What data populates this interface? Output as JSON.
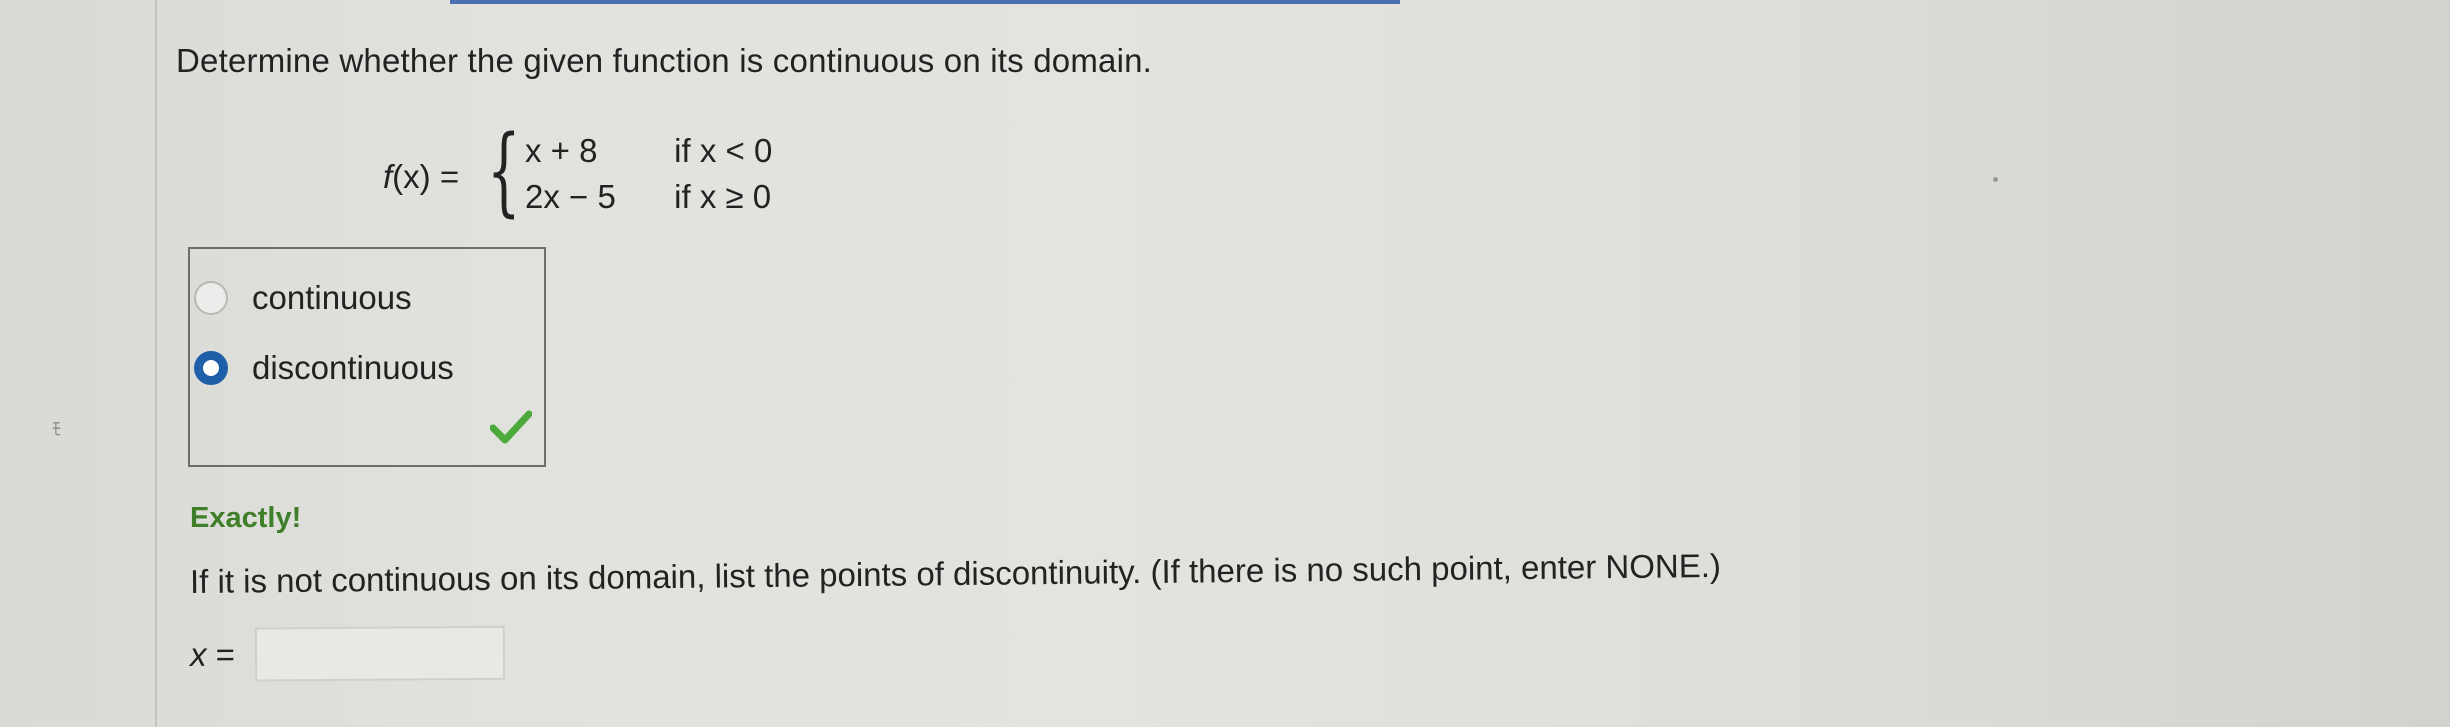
{
  "question": {
    "text": "Determine whether the given function is continuous on its domain."
  },
  "function": {
    "name": "f",
    "argument": "(x)",
    "equals": "=",
    "cases": [
      {
        "expression": "x + 8",
        "condition": "if x < 0"
      },
      {
        "expression": "2x − 5",
        "condition": "if x ≥ 0"
      }
    ]
  },
  "choices": {
    "options": [
      {
        "label": "continuous",
        "selected": false
      },
      {
        "label": "discontinuous",
        "selected": true
      }
    ],
    "correct_mark": "check-icon",
    "accent_color": "#1f5ea8",
    "check_color": "#4caa3a"
  },
  "feedback": {
    "text": "Exactly!",
    "color": "#3f7f29"
  },
  "followup": {
    "prompt": "If it is not continuous on its domain, list the points of discontinuity. (If there is no such point, enter NONE.)",
    "answer_label": "x",
    "answer_equals": "=",
    "answer_value": ""
  }
}
